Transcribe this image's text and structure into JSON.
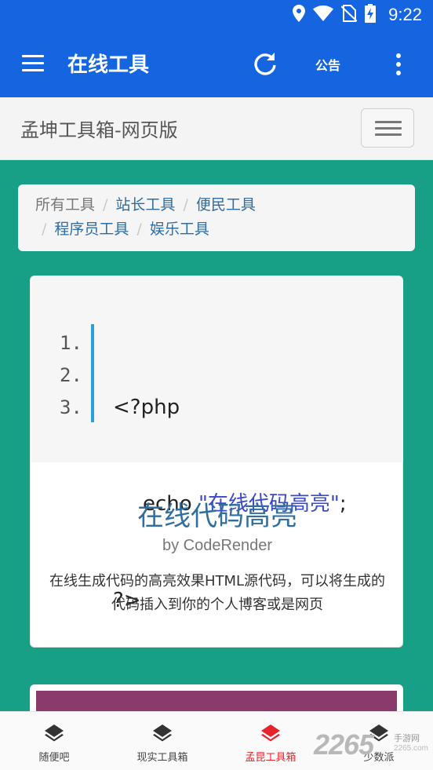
{
  "status_bar": {
    "time": "9:22",
    "icons": [
      "location-icon",
      "wifi-icon",
      "no-sim-icon",
      "battery-charging-icon"
    ]
  },
  "app_bar": {
    "title": "在线工具",
    "notice_label": "公告",
    "icons": [
      "menu-icon",
      "refresh-icon",
      "more-vert-icon"
    ]
  },
  "site_header": {
    "brand": "孟坤工具箱-网页版"
  },
  "breadcrumb": {
    "items": [
      "所有工具",
      "站长工具",
      "便民工具",
      "程序员工具",
      "娱乐工具"
    ],
    "separator": "/"
  },
  "tool_card": {
    "code_preview": {
      "line_numbers": [
        "1.",
        "2.",
        "3."
      ],
      "line1": "<?php",
      "line2_kw": "echo ",
      "line2_str": "\"在线代码高亮\"",
      "line2_end": ";",
      "line3": "?>"
    },
    "title": "在线代码高亮",
    "author": "by CodeRender",
    "description": "在线生成代码的高亮效果HTML源代码，可以将生成的代码插入到你的个人博客或是网页"
  },
  "bottom_nav": {
    "items": [
      {
        "label": "随便吧",
        "active": false
      },
      {
        "label": "现实工具箱",
        "active": false
      },
      {
        "label": "孟昆工具箱",
        "active": true
      },
      {
        "label": "少数派",
        "active": false
      }
    ]
  },
  "watermark": {
    "number": "2265",
    "line1": "手游网",
    "line2": "2265.com"
  },
  "colors": {
    "app_bar": "#1565e0",
    "page_bg": "#17a085",
    "link": "#2d6da3",
    "active_nav": "#e5242d",
    "code_rule": "#2b9fdc",
    "card2_accent": "#8b3a6e"
  }
}
